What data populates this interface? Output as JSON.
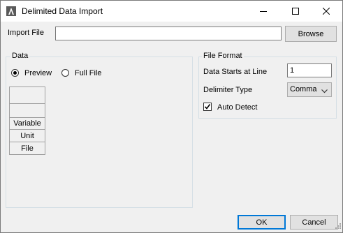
{
  "window": {
    "title": "Delimited Data Import",
    "icons": {
      "app": "app-logo-icon",
      "minimize": "minimize-icon",
      "maximize": "maximize-icon",
      "close": "close-icon"
    }
  },
  "import_file": {
    "label": "Import File",
    "value": "",
    "browse_label": "Browse"
  },
  "data_group": {
    "title": "Data",
    "radio_preview": "Preview",
    "radio_full_file": "Full File",
    "selected": "Preview",
    "row_headers": [
      "",
      "",
      "Variable",
      "Unit",
      "File"
    ]
  },
  "file_format": {
    "title": "File Format",
    "start_line_label": "Data Starts at Line",
    "start_line_value": "1",
    "delimiter_label": "Delimiter Type",
    "delimiter_value": "Comma",
    "auto_detect_label": "Auto Detect",
    "auto_detect_checked": true
  },
  "footer": {
    "ok_label": "OK",
    "cancel_label": "Cancel"
  }
}
